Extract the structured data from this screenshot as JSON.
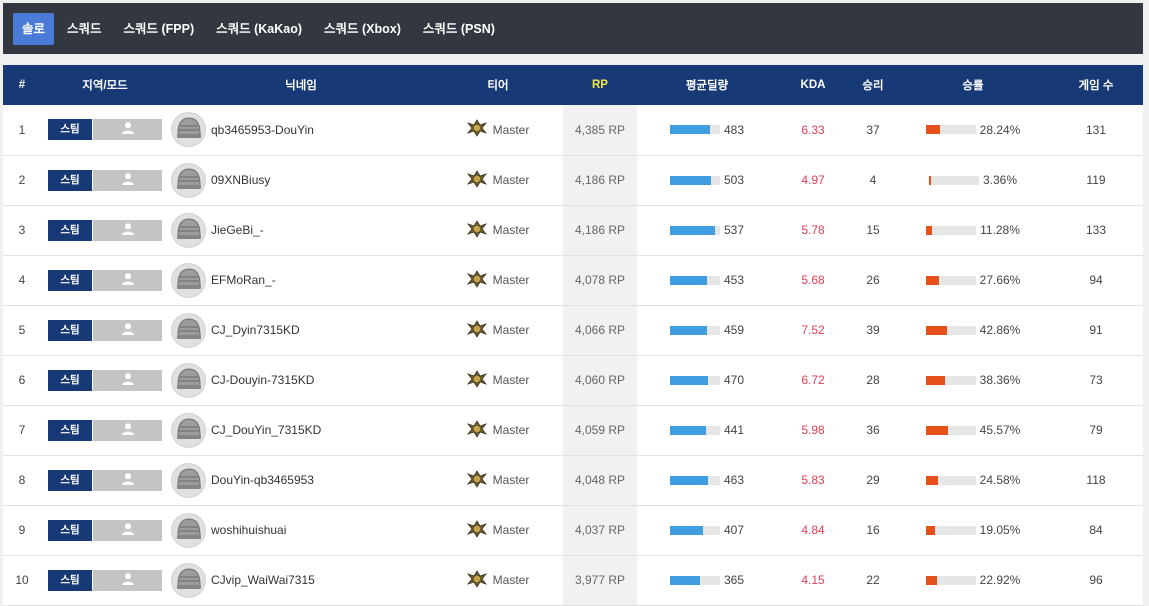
{
  "tabs": [
    {
      "label": "솔로",
      "active": true
    },
    {
      "label": "스쿼드",
      "active": false
    },
    {
      "label": "스쿼드 (FPP)",
      "active": false
    },
    {
      "label": "스쿼드 (KaKao)",
      "active": false
    },
    {
      "label": "스쿼드 (Xbox)",
      "active": false
    },
    {
      "label": "스쿼드 (PSN)",
      "active": false
    }
  ],
  "table": {
    "headers": {
      "rank": "#",
      "region": "지역/모드",
      "nickname": "닉네임",
      "tier": "티어",
      "rp": "RP",
      "avg_damage": "평균딜량",
      "kda": "KDA",
      "wins": "승리",
      "win_rate": "승률",
      "games": "게임 수"
    },
    "region_label": "스팀",
    "colors": {
      "header_bg": "#173a76",
      "rp_header": "#f5e942",
      "kda": "#e53e55",
      "damage_bar": "#3f9de0",
      "winrate_bar": "#e5501b",
      "active_tab": "#4a7bd6"
    },
    "rows": [
      {
        "rank": "1",
        "nickname": "qb3465953-DouYin",
        "tier": "Master",
        "rp": "4,385 RP",
        "avg_damage": "483",
        "damage_pct": 0.8,
        "kda": "6.33",
        "wins": "37",
        "win_rate": "28.24%",
        "win_pct": 0.2824,
        "games": "131"
      },
      {
        "rank": "2",
        "nickname": "09XNBiusy",
        "tier": "Master",
        "rp": "4,186 RP",
        "avg_damage": "503",
        "damage_pct": 0.82,
        "kda": "4.97",
        "wins": "4",
        "win_rate": "3.36%",
        "win_pct": 0.0336,
        "games": "119"
      },
      {
        "rank": "3",
        "nickname": "JieGeBi_-",
        "tier": "Master",
        "rp": "4,186 RP",
        "avg_damage": "537",
        "damage_pct": 0.9,
        "kda": "5.78",
        "wins": "15",
        "win_rate": "11.28%",
        "win_pct": 0.1128,
        "games": "133"
      },
      {
        "rank": "4",
        "nickname": "EFMoRan_-",
        "tier": "Master",
        "rp": "4,078 RP",
        "avg_damage": "453",
        "damage_pct": 0.74,
        "kda": "5.68",
        "wins": "26",
        "win_rate": "27.66%",
        "win_pct": 0.2766,
        "games": "94"
      },
      {
        "rank": "5",
        "nickname": "CJ_Dyin7315KD",
        "tier": "Master",
        "rp": "4,066 RP",
        "avg_damage": "459",
        "damage_pct": 0.75,
        "kda": "7.52",
        "wins": "39",
        "win_rate": "42.86%",
        "win_pct": 0.4286,
        "games": "91"
      },
      {
        "rank": "6",
        "nickname": "CJ-Douyin-7315KD",
        "tier": "Master",
        "rp": "4,060 RP",
        "avg_damage": "470",
        "damage_pct": 0.77,
        "kda": "6.72",
        "wins": "28",
        "win_rate": "38.36%",
        "win_pct": 0.3836,
        "games": "73"
      },
      {
        "rank": "7",
        "nickname": "CJ_DouYin_7315KD",
        "tier": "Master",
        "rp": "4,059 RP",
        "avg_damage": "441",
        "damage_pct": 0.72,
        "kda": "5.98",
        "wins": "36",
        "win_rate": "45.57%",
        "win_pct": 0.4557,
        "games": "79"
      },
      {
        "rank": "8",
        "nickname": "DouYin-qb3465953",
        "tier": "Master",
        "rp": "4,048 RP",
        "avg_damage": "463",
        "damage_pct": 0.76,
        "kda": "5.83",
        "wins": "29",
        "win_rate": "24.58%",
        "win_pct": 0.2458,
        "games": "118"
      },
      {
        "rank": "9",
        "nickname": "woshihuishuai",
        "tier": "Master",
        "rp": "4,037 RP",
        "avg_damage": "407",
        "damage_pct": 0.67,
        "kda": "4.84",
        "wins": "16",
        "win_rate": "19.05%",
        "win_pct": 0.1905,
        "games": "84"
      },
      {
        "rank": "10",
        "nickname": "CJvip_WaiWai7315",
        "tier": "Master",
        "rp": "3,977 RP",
        "avg_damage": "365",
        "damage_pct": 0.6,
        "kda": "4.15",
        "wins": "22",
        "win_rate": "22.92%",
        "win_pct": 0.2292,
        "games": "96"
      }
    ]
  }
}
